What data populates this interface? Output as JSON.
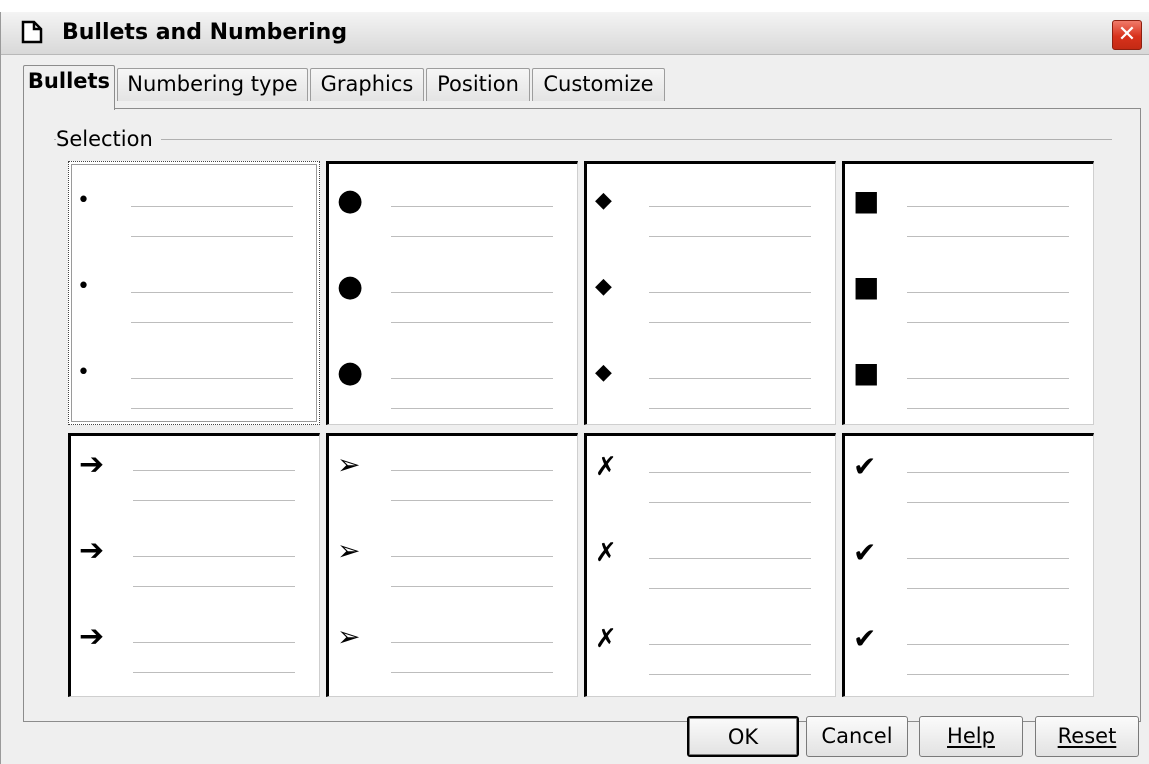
{
  "window": {
    "title": "Bullets and Numbering",
    "close_glyph": "✕"
  },
  "tabs": [
    {
      "label": "Bullets",
      "active": true
    },
    {
      "label": "Numbering type",
      "active": false
    },
    {
      "label": "Graphics",
      "active": false
    },
    {
      "label": "Position",
      "active": false
    },
    {
      "label": "Customize",
      "active": false
    }
  ],
  "selection": {
    "label": "Selection",
    "styles": [
      {
        "name": "small-dot-bullet",
        "glyph": "•",
        "selected": true
      },
      {
        "name": "large-dot-bullet",
        "glyph": "●",
        "selected": false
      },
      {
        "name": "diamond-bullet",
        "glyph": "◆",
        "selected": false
      },
      {
        "name": "square-bullet",
        "glyph": "■",
        "selected": false
      },
      {
        "name": "bold-arrow-bullet",
        "glyph": "➔",
        "selected": false
      },
      {
        "name": "arrowhead-bullet",
        "glyph": "➢",
        "selected": false
      },
      {
        "name": "cross-mark-bullet",
        "glyph": "✗",
        "selected": false
      },
      {
        "name": "check-mark-bullet",
        "glyph": "✔",
        "selected": false
      }
    ]
  },
  "buttons": {
    "ok": "OK",
    "cancel": "Cancel",
    "help": "Help",
    "reset": "Reset"
  },
  "colors": {
    "close": "#d8321c",
    "panel": "#efefef"
  }
}
